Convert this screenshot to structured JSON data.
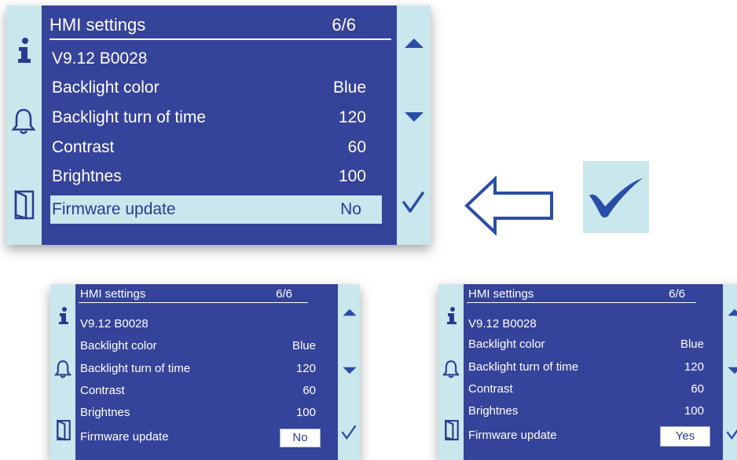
{
  "panels": {
    "main": {
      "title": "HMI settings",
      "page": "6/6",
      "version": "V9.12  B0028",
      "rows": [
        {
          "label": "Backlight color",
          "value": "Blue"
        },
        {
          "label": "Backlight turn of time",
          "value": "120"
        },
        {
          "label": "Contrast",
          "value": "60"
        },
        {
          "label": "Brightnes",
          "value": "100"
        },
        {
          "label": "Firmware update",
          "value": "No"
        }
      ]
    },
    "small_no": {
      "title": "HMI settings",
      "page": "6/6",
      "version": "V9.12  B0028",
      "rows": [
        {
          "label": "Backlight color",
          "value": "Blue"
        },
        {
          "label": "Backlight turn of time",
          "value": "120"
        },
        {
          "label": "Contrast",
          "value": "60"
        },
        {
          "label": "Brightnes",
          "value": "100"
        },
        {
          "label": "Firmware update",
          "value": "No"
        }
      ]
    },
    "small_yes": {
      "title": "HMI settings",
      "page": "6/6",
      "version": "V9.12  B0028",
      "rows": [
        {
          "label": "Backlight color",
          "value": "Blue"
        },
        {
          "label": "Backlight turn of time",
          "value": "120"
        },
        {
          "label": "Contrast",
          "value": "60"
        },
        {
          "label": "Brightnes",
          "value": "100"
        },
        {
          "label": "Firmware update",
          "value": "Yes"
        }
      ]
    }
  },
  "icons": {
    "info": "info-icon",
    "bell": "bell-icon",
    "exit": "exit-door-icon",
    "up": "scroll-up-arrow-icon",
    "down": "scroll-down-arrow-icon",
    "confirm": "checkmark-icon",
    "arrow": "left-arrow-icon"
  },
  "colors": {
    "screen_bg": "#35439a",
    "bar_bg": "#c9e7ec",
    "icon_blue": "#2a4ea8",
    "text": "#ffffff"
  }
}
